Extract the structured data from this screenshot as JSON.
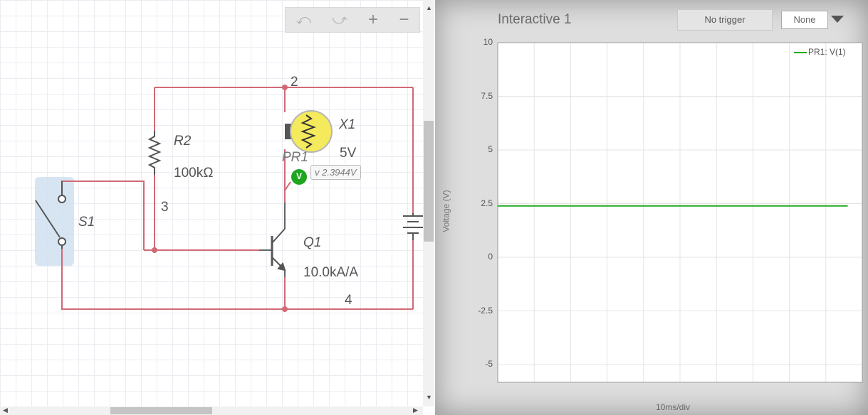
{
  "toolbar": {
    "undo": "⤺",
    "redo": "⤻",
    "zoom_in": "+",
    "zoom_out": "−"
  },
  "circuit": {
    "labels": {
      "node2": "2",
      "node3": "3",
      "node4": "4",
      "x1": "X1",
      "x1_value": "5V",
      "r2": "R2",
      "r2_value": "100kΩ",
      "q1": "Q1",
      "q1_value": "10.0kA/A",
      "s1": "S1",
      "pr1": "PR1",
      "probe_badge": "V"
    },
    "probe_reading": "v 2.3944V",
    "colors": {
      "wire": "#d16a75",
      "component": "#555555",
      "lamp": "#f4ea5c",
      "probe": "#1fa51f",
      "switch_highlight": "#cfe0ee"
    }
  },
  "scope": {
    "title": "Interactive 1",
    "trigger_button": "No trigger",
    "trigger_select": "None",
    "y_axis_label": "Voltage (V)",
    "x_axis_label": "10ms/div",
    "y_ticks": [
      "10",
      "7.5",
      "5",
      "2.5",
      "0",
      "-2.5",
      "-5"
    ],
    "legend": "PR1: V(1)"
  },
  "chart_data": {
    "type": "line",
    "title": "Interactive 1",
    "xlabel": "10ms/div",
    "ylabel": "Voltage (V)",
    "ylim": [
      -6,
      10
    ],
    "y_ticks": [
      10,
      7.5,
      5,
      2.5,
      0,
      -2.5,
      -5
    ],
    "grid": true,
    "legend_position": "top-right",
    "series": [
      {
        "name": "PR1: V(1)",
        "color": "#22aa22",
        "x_div": [
          0,
          9.6
        ],
        "values": [
          2.3944,
          2.3944
        ]
      }
    ]
  }
}
